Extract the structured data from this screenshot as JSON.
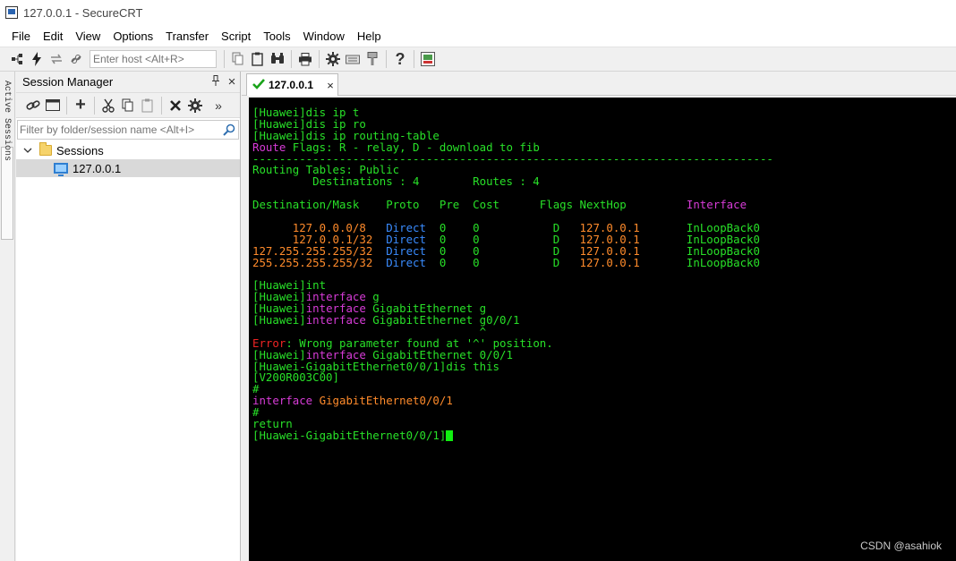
{
  "window": {
    "title": "127.0.0.1 - SecureCRT"
  },
  "menu": [
    "File",
    "Edit",
    "View",
    "Options",
    "Transfer",
    "Script",
    "Tools",
    "Window",
    "Help"
  ],
  "toolbar": {
    "host_placeholder": "Enter host <Alt+R>",
    "icons": [
      "connect-tree-icon",
      "quick-connect-icon",
      "reconnect-icon",
      "disconnect-icon",
      "copy-icon",
      "paste-icon",
      "find-icon",
      "print-icon",
      "settings-icon",
      "keymap-icon",
      "key-icon",
      "help-icon",
      "sftp-icon"
    ]
  },
  "active_sessions": {
    "label": "Active Sessions"
  },
  "session_manager": {
    "title": "Session Manager",
    "pin": "Ȅ",
    "close": "×",
    "more": "»",
    "filter_placeholder": "Filter by folder/session name <Alt+I>",
    "folder": "Sessions",
    "session": "127.0.0.1"
  },
  "tab": {
    "label": "127.0.0.1",
    "close": "×",
    "status_color": "#1aa31a"
  },
  "terminal": {
    "lines": [
      [
        [
          "g",
          "[Huawei]dis ip t"
        ]
      ],
      [
        [
          "g",
          "[Huawei]dis ip ro"
        ]
      ],
      [
        [
          "g",
          "[Huawei]dis ip routing-table"
        ]
      ],
      [
        [
          "m",
          "Route "
        ],
        [
          "g",
          "Flags: R - relay, D - download to fib"
        ]
      ],
      [
        [
          "g",
          "------------------------------------------------------------------------------"
        ]
      ],
      [
        [
          "g",
          "Routing Tables: Public"
        ]
      ],
      [
        [
          "g",
          "         Destinations : 4        Routes : 4"
        ]
      ],
      [
        [
          "g",
          ""
        ]
      ],
      [
        [
          "g",
          "Destination/Mask    Proto   Pre  Cost      Flags NextHop         "
        ],
        [
          "m",
          "Interface"
        ]
      ],
      [
        [
          "g",
          ""
        ]
      ],
      [
        [
          "o",
          "      127.0.0.0/8   "
        ],
        [
          "b",
          "Direct"
        ],
        [
          "g",
          "  0    0           D   "
        ],
        [
          "o",
          "127.0.0.1"
        ],
        [
          "g",
          "       InLoopBack0"
        ]
      ],
      [
        [
          "o",
          "      127.0.0.1/32  "
        ],
        [
          "b",
          "Direct"
        ],
        [
          "g",
          "  0    0           D   "
        ],
        [
          "o",
          "127.0.0.1"
        ],
        [
          "g",
          "       InLoopBack0"
        ]
      ],
      [
        [
          "o",
          "127.255.255.255/32  "
        ],
        [
          "b",
          "Direct"
        ],
        [
          "g",
          "  0    0           D   "
        ],
        [
          "o",
          "127.0.0.1"
        ],
        [
          "g",
          "       InLoopBack0"
        ]
      ],
      [
        [
          "o",
          "255.255.255.255/32  "
        ],
        [
          "b",
          "Direct"
        ],
        [
          "g",
          "  0    0           D   "
        ],
        [
          "o",
          "127.0.0.1"
        ],
        [
          "g",
          "       InLoopBack0"
        ]
      ],
      [
        [
          "g",
          ""
        ]
      ],
      [
        [
          "g",
          "[Huawei]int"
        ]
      ],
      [
        [
          "g",
          "[Huawei]"
        ],
        [
          "m",
          "interface "
        ],
        [
          "g",
          "g"
        ]
      ],
      [
        [
          "g",
          "[Huawei]"
        ],
        [
          "m",
          "interface "
        ],
        [
          "g",
          "GigabitEthernet g"
        ]
      ],
      [
        [
          "g",
          "[Huawei]"
        ],
        [
          "m",
          "interface "
        ],
        [
          "g",
          "GigabitEthernet g0/0/1"
        ]
      ],
      [
        [
          "g",
          "                                  ^"
        ]
      ],
      [
        [
          "r",
          "Error"
        ],
        [
          "g",
          ": Wrong parameter found at '^' position."
        ]
      ],
      [
        [
          "g",
          "[Huawei]"
        ],
        [
          "m",
          "interface "
        ],
        [
          "g",
          "GigabitEthernet 0/0/1"
        ]
      ],
      [
        [
          "g",
          "[Huawei-GigabitEthernet0/0/1]dis this"
        ]
      ],
      [
        [
          "g",
          "[V200R003C00]"
        ]
      ],
      [
        [
          "g",
          "#"
        ]
      ],
      [
        [
          "m",
          "interface "
        ],
        [
          "o",
          "GigabitEthernet0/0/1"
        ]
      ],
      [
        [
          "g",
          "#"
        ]
      ],
      [
        [
          "g",
          "return"
        ]
      ],
      [
        [
          "g",
          "[Huawei-GigabitEthernet0/0/1]"
        ]
      ]
    ]
  },
  "watermark": "CSDN @asahiok",
  "colors": {
    "terminal_bg": "#000000",
    "green": "#28e028",
    "magenta": "#d83cd8",
    "orange": "#ff8b2b",
    "blue": "#3a8cff",
    "red": "#f02424"
  }
}
